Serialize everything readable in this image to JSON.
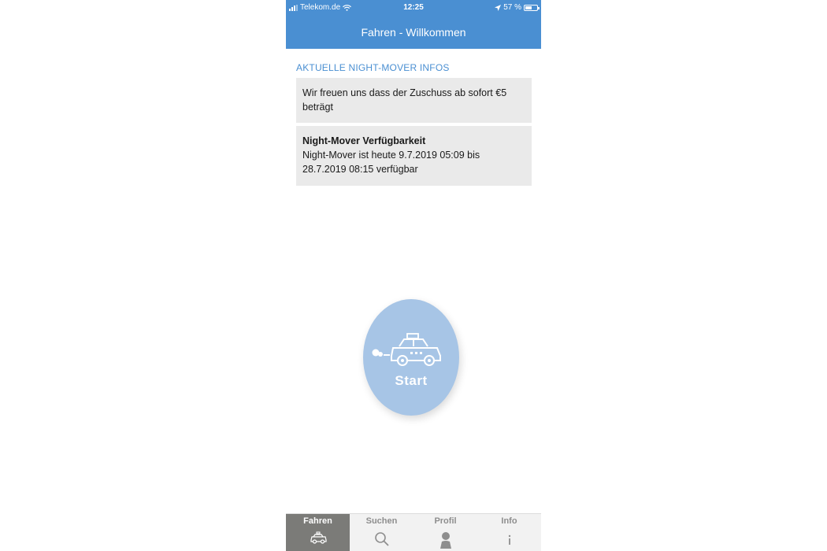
{
  "status_bar": {
    "carrier": "Telekom.de",
    "time": "12:25",
    "battery": "57 %",
    "battery_level": 0.57
  },
  "nav": {
    "title": "Fahren - Willkommen"
  },
  "infos": {
    "header": "AKTUELLE NIGHT-MOVER INFOS",
    "cards": [
      {
        "title": "",
        "text": "Wir freuen uns dass der Zuschuss ab sofort €5 beträgt"
      },
      {
        "title": "Night-Mover Verfügbarkeit",
        "text": "Night-Mover ist heute 9.7.2019 05:09 bis 28.7.2019 08:15 verfügbar"
      }
    ]
  },
  "start_button": {
    "label": "Start",
    "icon": "taxi-icon"
  },
  "tabs": [
    {
      "label": "Fahren",
      "icon": "taxi-icon",
      "active": true
    },
    {
      "label": "Suchen",
      "icon": "search-icon",
      "active": false
    },
    {
      "label": "Profil",
      "icon": "person-icon",
      "active": false
    },
    {
      "label": "Info",
      "icon": "info-icon",
      "active": false
    }
  ],
  "colors": {
    "accent": "#4a8fd2",
    "start_button": "#a7c5e6",
    "card_bg": "#eaeaea",
    "active_tab": "#7b7b78"
  }
}
